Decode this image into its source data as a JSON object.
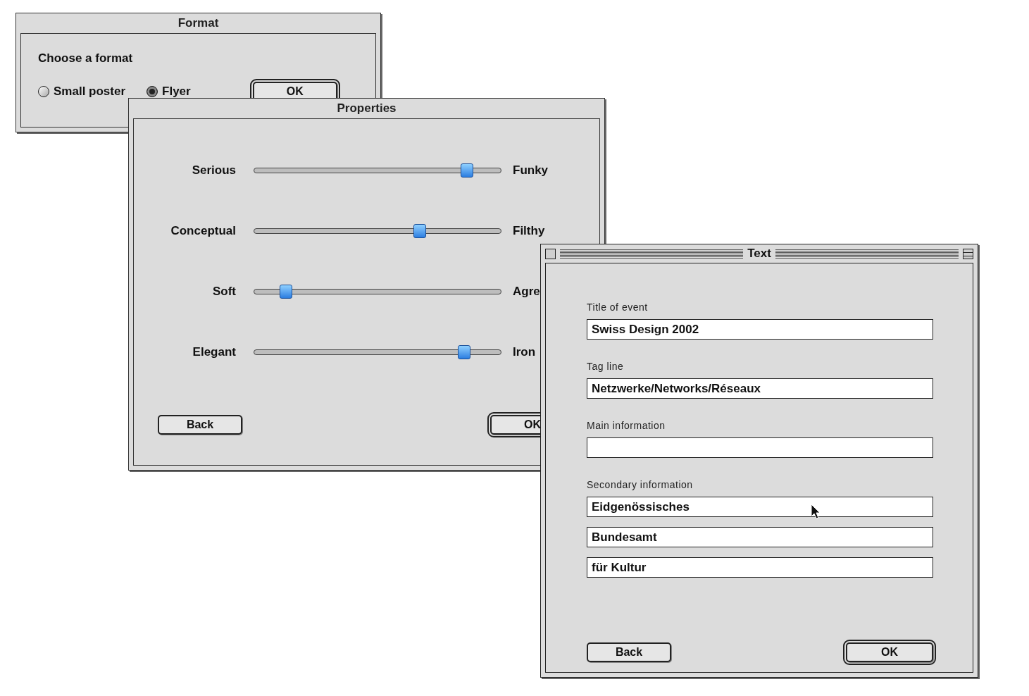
{
  "format_window": {
    "title": "Format",
    "prompt": "Choose a format",
    "options": [
      {
        "label": "Small poster",
        "selected": false
      },
      {
        "label": "Flyer",
        "selected": true
      }
    ],
    "ok_button": "OK"
  },
  "properties_window": {
    "title": "Properties",
    "sliders": [
      {
        "left": "Serious",
        "right": "Funky",
        "level": 0.86
      },
      {
        "left": "Conceptual",
        "right": "Filthy",
        "level": 0.67
      },
      {
        "left": "Soft",
        "right": "Agre",
        "level": 0.13
      },
      {
        "left": "Elegant",
        "right": "Iron",
        "level": 0.85
      }
    ],
    "back_button": "Back",
    "ok_button": "OK"
  },
  "text_window": {
    "title": "Text",
    "sections": [
      {
        "label": "Title of event",
        "fields": [
          {
            "kind": "input",
            "value": "Swiss Design 2002"
          }
        ]
      },
      {
        "label": "Tag line",
        "fields": [
          {
            "kind": "input",
            "value": "Netzwerke/Networks/Réseaux"
          }
        ]
      },
      {
        "label": "Main information",
        "fields": [
          {
            "kind": "input"
          }
        ]
      },
      {
        "label": "Secondary information",
        "fields": [
          {
            "kind": "input",
            "value": "Eidgenössisches"
          },
          {
            "kind": "input",
            "value": "Bundesamt"
          },
          {
            "kind": "input",
            "value": "für Kultur"
          }
        ]
      }
    ],
    "back_button": "Back",
    "ok_button": "OK"
  }
}
